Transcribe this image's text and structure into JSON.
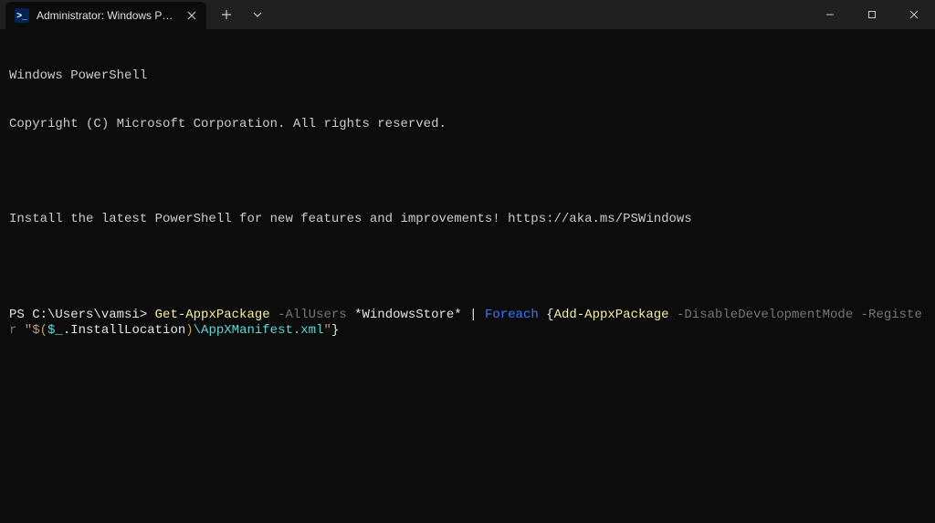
{
  "titlebar": {
    "tab_title": "Administrator: Windows PowerS",
    "tab_icon_text": ">_"
  },
  "terminal": {
    "line1": "Windows PowerShell",
    "line2": "Copyright (C) Microsoft Corporation. All rights reserved.",
    "line3": "Install the latest PowerShell for new features and improvements! https://aka.ms/PSWindows",
    "prompt": "PS C:\\Users\\vamsi> ",
    "cmd": {
      "get_appx": "Get-AppxPackage",
      "flag_allusers": " -AllUsers ",
      "store_glob": "*WindowsStore*",
      "pipe": " | ",
      "foreach": "Foreach",
      "brace_open": " {",
      "add_appx": "Add-AppxPackage",
      "flag_ddm": " -DisableDevelopmentMode ",
      "flag_register": "-Register",
      "str_open": " \"$(",
      "dollar_underscore": "$_",
      "dot_install": ".InstallLocation",
      "paren_close": ")",
      "manifest": "\\AppXManifest.xml",
      "str_close": "\"",
      "brace_close": "}"
    }
  }
}
